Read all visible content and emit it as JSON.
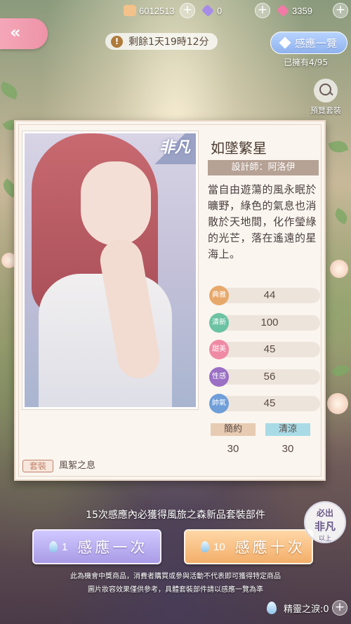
{
  "topbar": {
    "gold": {
      "value": "6012513",
      "icon": "cat-coin-icon",
      "color": "#f3c28a"
    },
    "diamond": {
      "value": "0",
      "icon": "purple-gem-icon",
      "color": "#a68be8"
    },
    "pink_diamond": {
      "value": "3359",
      "icon": "pink-gem-icon",
      "color": "#f27aa6"
    },
    "plus": "+"
  },
  "header": {
    "back_glyph": "«",
    "timer_icon": "!",
    "timer_text": "剩餘1天19時12分",
    "overview_label": "感應一覽",
    "owned_text": "已擁有4/95",
    "preview_label": "預覽套裝"
  },
  "card": {
    "rarity_badge": "非凡",
    "name": "如墜繁星",
    "designer": "設計師：阿洛伊",
    "description": "當自由遊蕩的風永眠於曠野，綠色的氣息也消散於天地間，化作瑩綠的光芒，落在遙遠的星海上。",
    "attributes": [
      {
        "label": "典雅",
        "value": "44",
        "color": "#e7a86b"
      },
      {
        "label": "清新",
        "value": "100",
        "color": "#6cc3a4"
      },
      {
        "label": "甜美",
        "value": "45",
        "color": "#ef8aa5"
      },
      {
        "label": "性感",
        "value": "56",
        "color": "#9a6fc4"
      },
      {
        "label": "帥氣",
        "value": "45",
        "color": "#6f9ed9"
      }
    ],
    "tags": [
      {
        "label": "簡約",
        "value": "30",
        "color": "#e7cbb2"
      },
      {
        "label": "清涼",
        "value": "30",
        "color": "#a8dbe6"
      }
    ],
    "suit_chip": "套裝",
    "suit_label": "風絮之息"
  },
  "bottom": {
    "guarantee_text": "15次感應內必獲得風旅之森新品套裝部件",
    "pull_one": {
      "count": "1",
      "label": "感應一次"
    },
    "pull_ten": {
      "count": "10",
      "label": "感應十次"
    },
    "must_badge": {
      "l1": "必出",
      "l2": "非凡",
      "l3": "以上"
    },
    "disclaimer_1": "此為機會中獎商品，消費者購買或參與活動不代表即可獲得特定商品",
    "disclaimer_2": "圖片妝容效果僅供參考，具體套裝部件請以感應一覽為準",
    "spirit_text": "精靈之淚:0",
    "spirit_plus": "+"
  }
}
